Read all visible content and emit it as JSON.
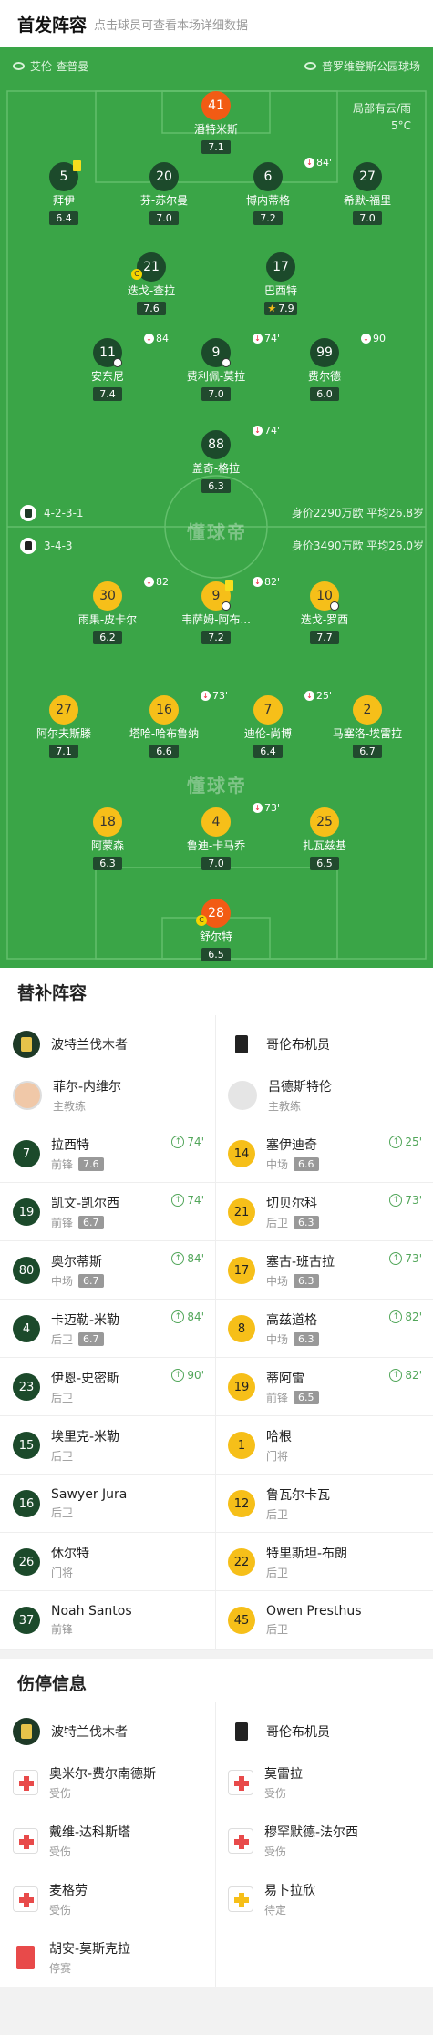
{
  "header": {
    "title": "首发阵容",
    "subtitle": "点击球员可查看本场详细数据"
  },
  "pitch": {
    "home_team": "艾伦-查普曼",
    "away_team": "普罗维登斯公园球场",
    "weather_line1": "局部有云/雨",
    "weather_line2": "5°C",
    "watermark": "懂球帝",
    "home_formation": "4-2-3-1",
    "home_stats": "身价2290万欧 平均26.8岁",
    "away_formation": "3-4-3",
    "away_stats": "身价3490万欧 平均26.0岁",
    "players": [
      {
        "no": "41",
        "name": "潘特米斯",
        "rating": "7.1",
        "color": "o"
      },
      {
        "no": "5",
        "name": "拜伊",
        "rating": "6.4",
        "color": "g"
      },
      {
        "no": "20",
        "name": "芬-苏尔曼",
        "rating": "7.0",
        "color": "g"
      },
      {
        "no": "6",
        "name": "博内蒂格",
        "rating": "7.2",
        "color": "g",
        "event": "84'"
      },
      {
        "no": "27",
        "name": "希默-福里",
        "rating": "7.0",
        "color": "g"
      },
      {
        "no": "21",
        "name": "迭戈-查拉",
        "rating": "7.6",
        "color": "g"
      },
      {
        "no": "17",
        "name": "巴西特",
        "rating": "7.9",
        "color": "g"
      },
      {
        "no": "11",
        "name": "安东尼",
        "rating": "7.4",
        "color": "g",
        "event": "84'"
      },
      {
        "no": "9",
        "name": "费利佩-莫拉",
        "rating": "7.0",
        "color": "g",
        "event": "74'"
      },
      {
        "no": "99",
        "name": "费尔德",
        "rating": "6.0",
        "color": "g",
        "event": "90'"
      },
      {
        "no": "88",
        "name": "盖奇-格拉",
        "rating": "6.3",
        "color": "g",
        "event": "74'"
      },
      {
        "no": "30",
        "name": "雨果-皮卡尔",
        "rating": "6.2",
        "color": "y",
        "event": "82'"
      },
      {
        "no": "9",
        "name": "韦萨姆-阿布...",
        "rating": "7.2",
        "color": "y",
        "event": "82'"
      },
      {
        "no": "10",
        "name": "迭戈-罗西",
        "rating": "7.7",
        "color": "y"
      },
      {
        "no": "27",
        "name": "阿尔夫斯滕",
        "rating": "7.1",
        "color": "y"
      },
      {
        "no": "16",
        "name": "塔哈-哈布鲁纳",
        "rating": "6.6",
        "color": "y",
        "event": "73'"
      },
      {
        "no": "7",
        "name": "迪伦-尚博",
        "rating": "6.4",
        "color": "y",
        "event": "25'"
      },
      {
        "no": "2",
        "name": "马塞洛-埃雷拉",
        "rating": "6.7",
        "color": "y"
      },
      {
        "no": "18",
        "name": "阿蒙森",
        "rating": "6.3",
        "color": "y"
      },
      {
        "no": "4",
        "name": "鲁迪-卡马乔",
        "rating": "7.0",
        "color": "y",
        "event": "73'"
      },
      {
        "no": "25",
        "name": "扎瓦兹基",
        "rating": "6.5",
        "color": "y"
      },
      {
        "no": "28",
        "name": "舒尔特",
        "rating": "6.5",
        "color": "o"
      }
    ]
  },
  "subs": {
    "title": "替补阵容",
    "home_team": "波特兰伐木者",
    "away_team": "哥伦布机员",
    "home_coach": {
      "name": "菲尔-内维尔",
      "role": "主教练"
    },
    "away_coach": {
      "name": "吕德斯特伦",
      "role": "主教练"
    },
    "rows": [
      {
        "l": {
          "no": "7",
          "name": "拉西特",
          "pos": "前锋",
          "rating": "7.6",
          "time": "74'"
        },
        "r": {
          "no": "14",
          "name": "塞伊迪奇",
          "pos": "中场",
          "rating": "6.6",
          "time": "25'"
        }
      },
      {
        "l": {
          "no": "19",
          "name": "凯文-凯尔西",
          "pos": "前锋",
          "rating": "6.7",
          "time": "74'"
        },
        "r": {
          "no": "21",
          "name": "切贝尔科",
          "pos": "后卫",
          "rating": "6.3",
          "time": "73'"
        }
      },
      {
        "l": {
          "no": "80",
          "name": "奥尔蒂斯",
          "pos": "中场",
          "rating": "6.7",
          "time": "84'"
        },
        "r": {
          "no": "17",
          "name": "塞古-班古拉",
          "pos": "中场",
          "rating": "6.3",
          "time": "73'"
        }
      },
      {
        "l": {
          "no": "4",
          "name": "卡迈勒-米勒",
          "pos": "后卫",
          "rating": "6.7",
          "time": "84'"
        },
        "r": {
          "no": "8",
          "name": "高兹道格",
          "pos": "中场",
          "rating": "6.3",
          "time": "82'"
        }
      },
      {
        "l": {
          "no": "23",
          "name": "伊恩-史密斯",
          "pos": "后卫",
          "time": "90'"
        },
        "r": {
          "no": "19",
          "name": "蒂阿雷",
          "pos": "前锋",
          "rating": "6.5",
          "time": "82'"
        }
      },
      {
        "l": {
          "no": "15",
          "name": "埃里克-米勒",
          "pos": "后卫"
        },
        "r": {
          "no": "1",
          "name": "哈根",
          "pos": "门将"
        }
      },
      {
        "l": {
          "no": "16",
          "name": "Sawyer Jura",
          "pos": "后卫"
        },
        "r": {
          "no": "12",
          "name": "鲁瓦尔卡瓦",
          "pos": "后卫"
        }
      },
      {
        "l": {
          "no": "26",
          "name": "休尔特",
          "pos": "门将"
        },
        "r": {
          "no": "22",
          "name": "特里斯坦-布朗",
          "pos": "后卫"
        }
      },
      {
        "l": {
          "no": "37",
          "name": "Noah Santos",
          "pos": "前锋"
        },
        "r": {
          "no": "45",
          "name": "Owen Presthus",
          "pos": "后卫"
        }
      }
    ]
  },
  "injuries": {
    "title": "伤停信息",
    "home_team": "波特兰伐木者",
    "away_team": "哥伦布机员",
    "rows": [
      {
        "l": {
          "name": "奥米尔-费尔南德斯",
          "status": "受伤"
        },
        "r": {
          "name": "莫雷拉",
          "status": "受伤"
        }
      },
      {
        "l": {
          "name": "戴维-达科斯塔",
          "status": "受伤"
        },
        "r": {
          "name": "穆罕默德-法尔西",
          "status": "受伤"
        }
      },
      {
        "l": {
          "name": "麦格劳",
          "status": "受伤"
        },
        "r": {
          "name": "易卜拉欣",
          "status": "待定"
        }
      },
      {
        "l": {
          "name": "胡安-莫斯克拉",
          "status": "停赛"
        }
      }
    ]
  }
}
